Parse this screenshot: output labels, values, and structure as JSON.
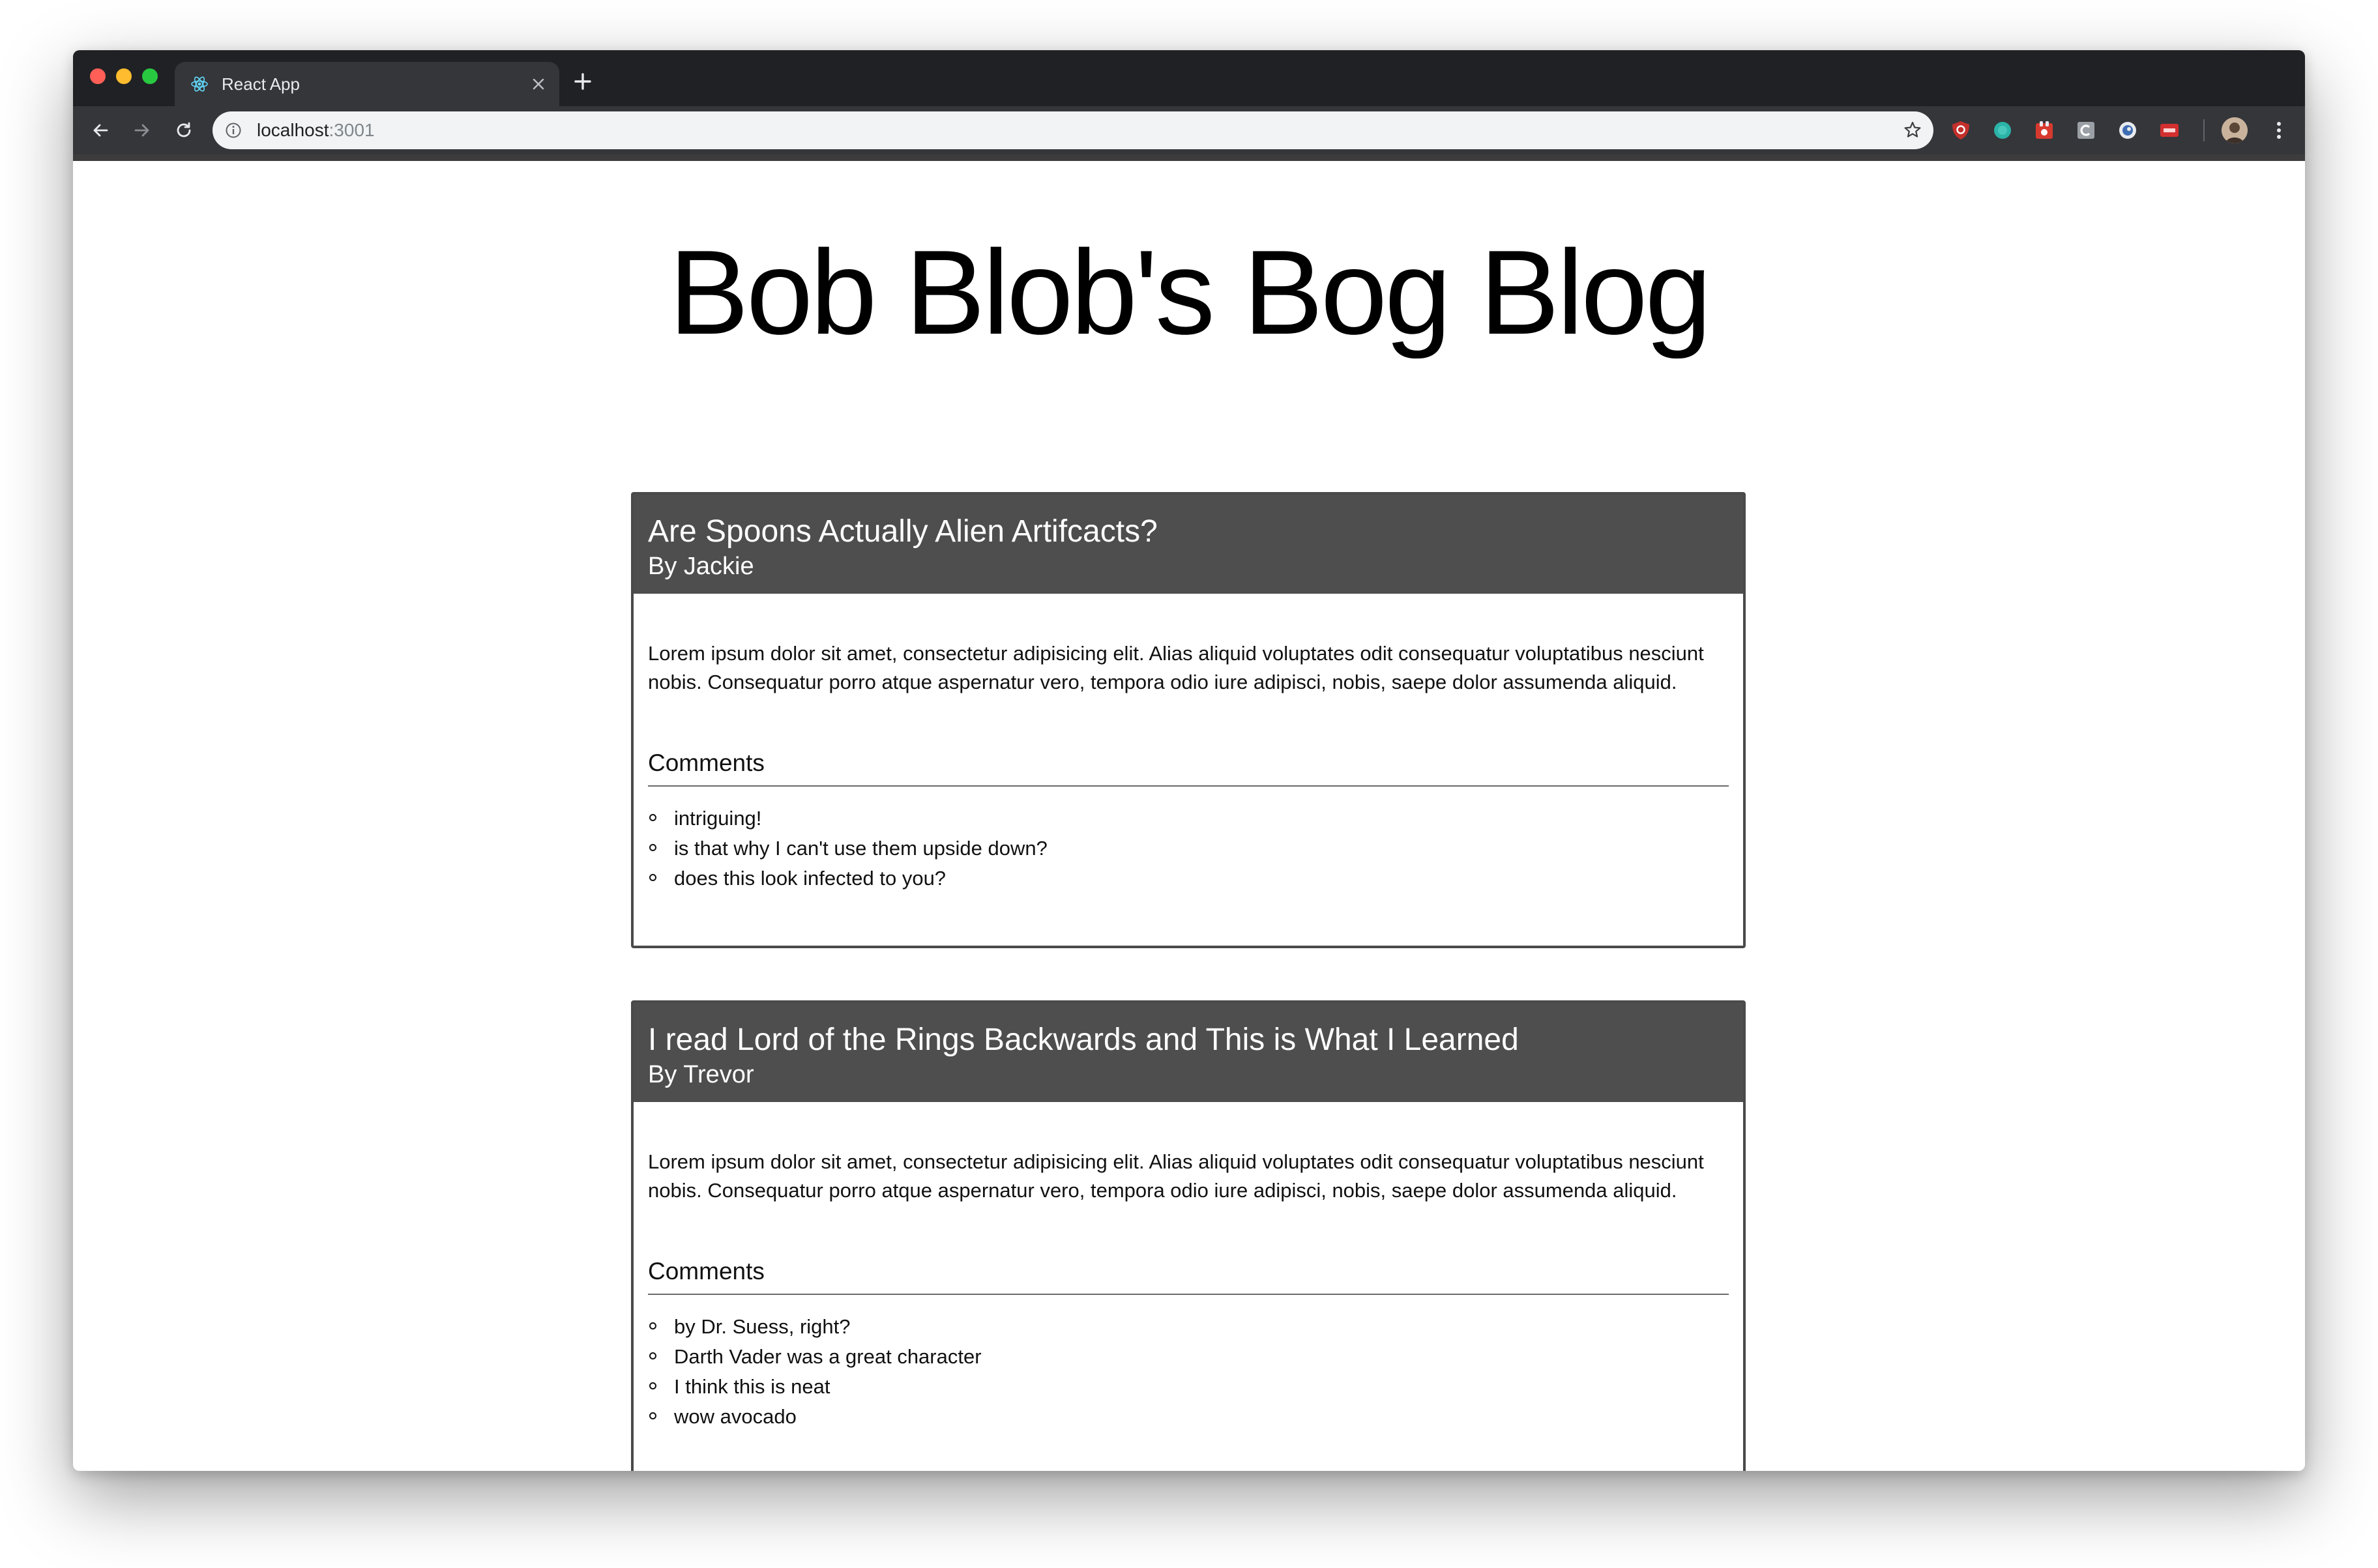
{
  "browser": {
    "tab_title": "React App",
    "url_host": "localhost",
    "url_port": ":3001"
  },
  "blog": {
    "title": "Bob Blob's Bog Blog",
    "posts": [
      {
        "title": "Are Spoons Actually Alien Artifcacts?",
        "author": "By Jackie",
        "body": "Lorem ipsum dolor sit amet, consectetur adipisicing elit. Alias aliquid voluptates odit consequatur voluptatibus nesciunt nobis. Consequatur porro atque aspernatur vero, tempora odio iure adipisci, nobis, saepe dolor assumenda aliquid.",
        "comments_heading": "Comments",
        "comments": [
          "intriguing!",
          "is that why I can't use them upside down?",
          "does this look infected to you?"
        ]
      },
      {
        "title": "I read Lord of the Rings Backwards and This is What I Learned",
        "author": "By Trevor",
        "body": "Lorem ipsum dolor sit amet, consectetur adipisicing elit. Alias aliquid voluptates odit consequatur voluptatibus nesciunt nobis. Consequatur porro atque aspernatur vero, tempora odio iure adipisci, nobis, saepe dolor assumenda aliquid.",
        "comments_heading": "Comments",
        "comments": [
          "by Dr. Suess, right?",
          "Darth Vader was a great character",
          "I think this is neat",
          "wow avocado"
        ]
      }
    ]
  },
  "colors": {
    "post_header_bg": "#4e4e4e",
    "post_border": "#4a4a4a",
    "browser_frame": "#202124",
    "browser_toolbar": "#35363a"
  },
  "icons": {
    "tab_favicon": "react-icon",
    "tab_close": "close-icon",
    "new_tab": "plus-icon",
    "back": "arrow-left-icon",
    "forward": "arrow-right-icon",
    "reload": "reload-icon",
    "site_info": "info-icon",
    "bookmark": "star-icon",
    "menu": "kebab-menu-icon"
  }
}
